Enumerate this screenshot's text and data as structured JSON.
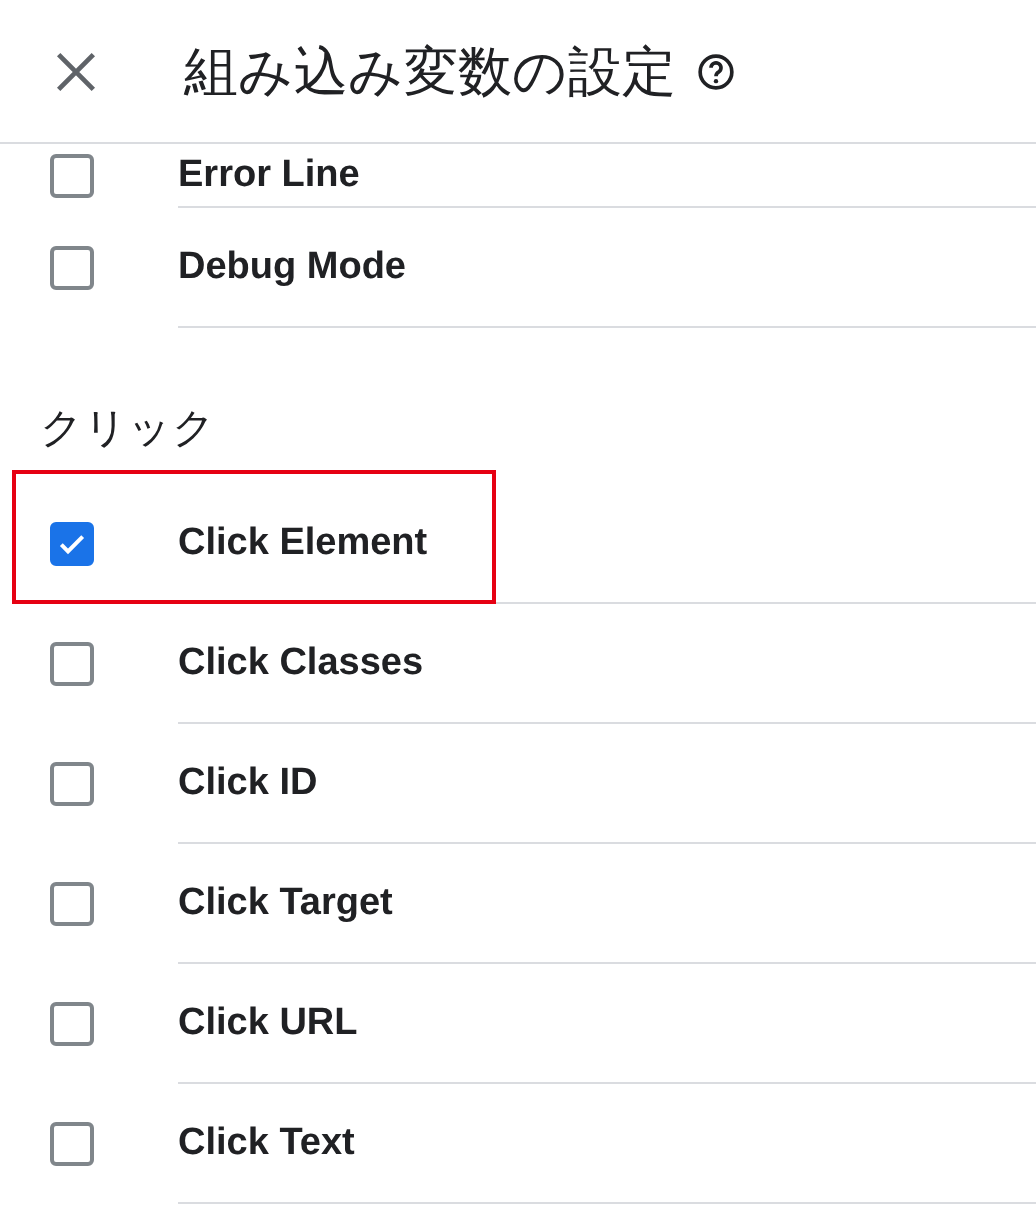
{
  "header": {
    "title": "組み込み変数の設定"
  },
  "sections": [
    {
      "items": [
        {
          "label": "Error Line",
          "checked": false,
          "highlighted": false
        },
        {
          "label": "Debug Mode",
          "checked": false,
          "highlighted": false
        }
      ]
    },
    {
      "heading": "クリック",
      "items": [
        {
          "label": "Click Element",
          "checked": true,
          "highlighted": true
        },
        {
          "label": "Click Classes",
          "checked": false,
          "highlighted": false
        },
        {
          "label": "Click ID",
          "checked": false,
          "highlighted": false
        },
        {
          "label": "Click Target",
          "checked": false,
          "highlighted": false
        },
        {
          "label": "Click URL",
          "checked": false,
          "highlighted": false
        },
        {
          "label": "Click Text",
          "checked": false,
          "highlighted": false
        }
      ]
    }
  ]
}
